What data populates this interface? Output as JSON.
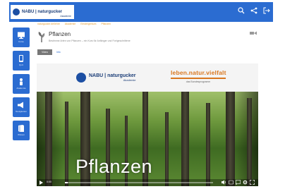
{
  "header": {
    "logo_text": "NABU | naturgucker",
    "logo_sub": "Akademie",
    "icons": [
      "search-icon",
      "share-icon",
      "logout-icon"
    ]
  },
  "sidebar": {
    "items": [
      {
        "label": "Kurse",
        "icon": "monitor-icon"
      },
      {
        "label": "Quiz",
        "icon": "tablet-icon"
      },
      {
        "label": "Akademie",
        "icon": "person-icon"
      },
      {
        "label": "Neuigkeiten",
        "icon": "megaphone-icon"
      },
      {
        "label": "Wissen",
        "icon": "book-icon"
      }
    ]
  },
  "breadcrumb": [
    "naturgucker.de/lehre",
    "Akademie",
    "Einsteigerkurs",
    "Pflanzen"
  ],
  "page": {
    "title": "Pflanzen",
    "subtitle": "Bestimme Arten von Pflanzen – ein Kurs für Anfänger und Fortgeschrittene"
  },
  "tabs": [
    {
      "label": "Video",
      "active": true
    },
    {
      "label": "Info",
      "active": false
    }
  ],
  "video": {
    "brand_text": "NABU | naturgucker",
    "brand_sub": "Akademie",
    "partner_title": "leben.natur.vielfalt",
    "partner_sub": "das Bundesprogramm",
    "title": "Pflanzen",
    "time": "0:00",
    "progress": 0.02
  },
  "colors": {
    "primary": "#2b6cd1",
    "accent": "#d9761f",
    "breadcrumb": "#e39b2e"
  }
}
